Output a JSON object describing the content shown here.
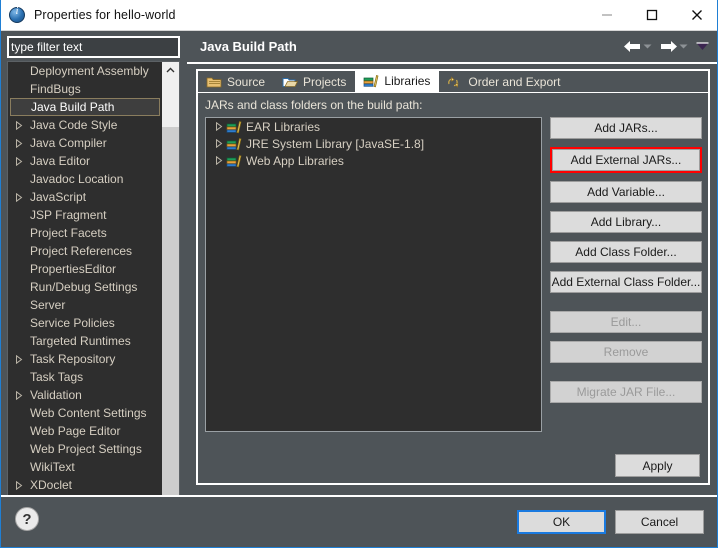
{
  "window": {
    "title": "Properties for hello-world",
    "icon": "properties-icon",
    "controls": {
      "minimize": "minimize-icon",
      "maximize": "maximize-icon",
      "close": "close-icon"
    }
  },
  "sidebar": {
    "filter": {
      "value": "type filter text",
      "placeholder": "type filter text",
      "selected": true
    },
    "items": [
      {
        "label": "Deployment Assembly",
        "expandable": false,
        "selected": false
      },
      {
        "label": "FindBugs",
        "expandable": false,
        "selected": false
      },
      {
        "label": "Java Build Path",
        "expandable": false,
        "selected": true
      },
      {
        "label": "Java Code Style",
        "expandable": true,
        "selected": false
      },
      {
        "label": "Java Compiler",
        "expandable": true,
        "selected": false
      },
      {
        "label": "Java Editor",
        "expandable": true,
        "selected": false
      },
      {
        "label": "Javadoc Location",
        "expandable": false,
        "selected": false
      },
      {
        "label": "JavaScript",
        "expandable": true,
        "selected": false
      },
      {
        "label": "JSP Fragment",
        "expandable": false,
        "selected": false
      },
      {
        "label": "Project Facets",
        "expandable": false,
        "selected": false
      },
      {
        "label": "Project References",
        "expandable": false,
        "selected": false
      },
      {
        "label": "PropertiesEditor",
        "expandable": false,
        "selected": false
      },
      {
        "label": "Run/Debug Settings",
        "expandable": false,
        "selected": false
      },
      {
        "label": "Server",
        "expandable": false,
        "selected": false
      },
      {
        "label": "Service Policies",
        "expandable": false,
        "selected": false
      },
      {
        "label": "Targeted Runtimes",
        "expandable": false,
        "selected": false
      },
      {
        "label": "Task Repository",
        "expandable": true,
        "selected": false
      },
      {
        "label": "Task Tags",
        "expandable": false,
        "selected": false
      },
      {
        "label": "Validation",
        "expandable": true,
        "selected": false
      },
      {
        "label": "Web Content Settings",
        "expandable": false,
        "selected": false
      },
      {
        "label": "Web Page Editor",
        "expandable": false,
        "selected": false
      },
      {
        "label": "Web Project Settings",
        "expandable": false,
        "selected": false
      },
      {
        "label": "WikiText",
        "expandable": false,
        "selected": false
      },
      {
        "label": "XDoclet",
        "expandable": true,
        "selected": false
      }
    ]
  },
  "main": {
    "page_title": "Java Build Path",
    "nav": {
      "back": "back-arrow-icon",
      "back_menu": "chevron-down-icon",
      "forward": "forward-arrow-icon",
      "forward_menu": "chevron-down-icon",
      "view_menu": "view-menu-icon"
    },
    "tabs": [
      {
        "label": "Source",
        "icon": "source-folder-icon",
        "active": false
      },
      {
        "label": "Projects",
        "icon": "projects-folder-icon",
        "active": false
      },
      {
        "label": "Libraries",
        "icon": "libraries-icon",
        "active": true
      },
      {
        "label": "Order and Export",
        "icon": "order-export-icon",
        "active": false
      }
    ],
    "tree_caption": "JARs and class folders on the build path:",
    "tree_items": [
      {
        "label": "EAR Libraries",
        "icon": "libraries-icon",
        "expandable": true
      },
      {
        "label": "JRE System Library [JavaSE-1.8]",
        "icon": "libraries-icon",
        "expandable": true
      },
      {
        "label": "Web App Libraries",
        "icon": "libraries-icon",
        "expandable": true
      }
    ],
    "buttons": [
      {
        "label": "Add JARs...",
        "disabled": false,
        "highlighted": false
      },
      {
        "label": "Add External JARs...",
        "disabled": false,
        "highlighted": true
      },
      {
        "label": "Add Variable...",
        "disabled": false,
        "highlighted": false
      },
      {
        "label": "Add Library...",
        "disabled": false,
        "highlighted": false
      },
      {
        "label": "Add Class Folder...",
        "disabled": false,
        "highlighted": false
      },
      {
        "label": "Add External Class Folder...",
        "disabled": false,
        "highlighted": false
      },
      {
        "label": "Edit...",
        "disabled": true,
        "highlighted": false
      },
      {
        "label": "Remove",
        "disabled": true,
        "highlighted": false
      },
      {
        "label": "Migrate JAR File...",
        "disabled": true,
        "highlighted": false
      }
    ],
    "apply_label": "Apply"
  },
  "footer": {
    "help_icon": "help-question-icon",
    "help_glyph": "?",
    "ok_label": "OK",
    "cancel_label": "Cancel"
  },
  "colors": {
    "dialog_bg": "#4e5458",
    "tree_bg": "#2e2e2e",
    "text": "#d6cfc2",
    "highlight_red": "#ff0000",
    "focus_blue": "#1a7ae0",
    "selection_blue": "#1a7ae0"
  }
}
